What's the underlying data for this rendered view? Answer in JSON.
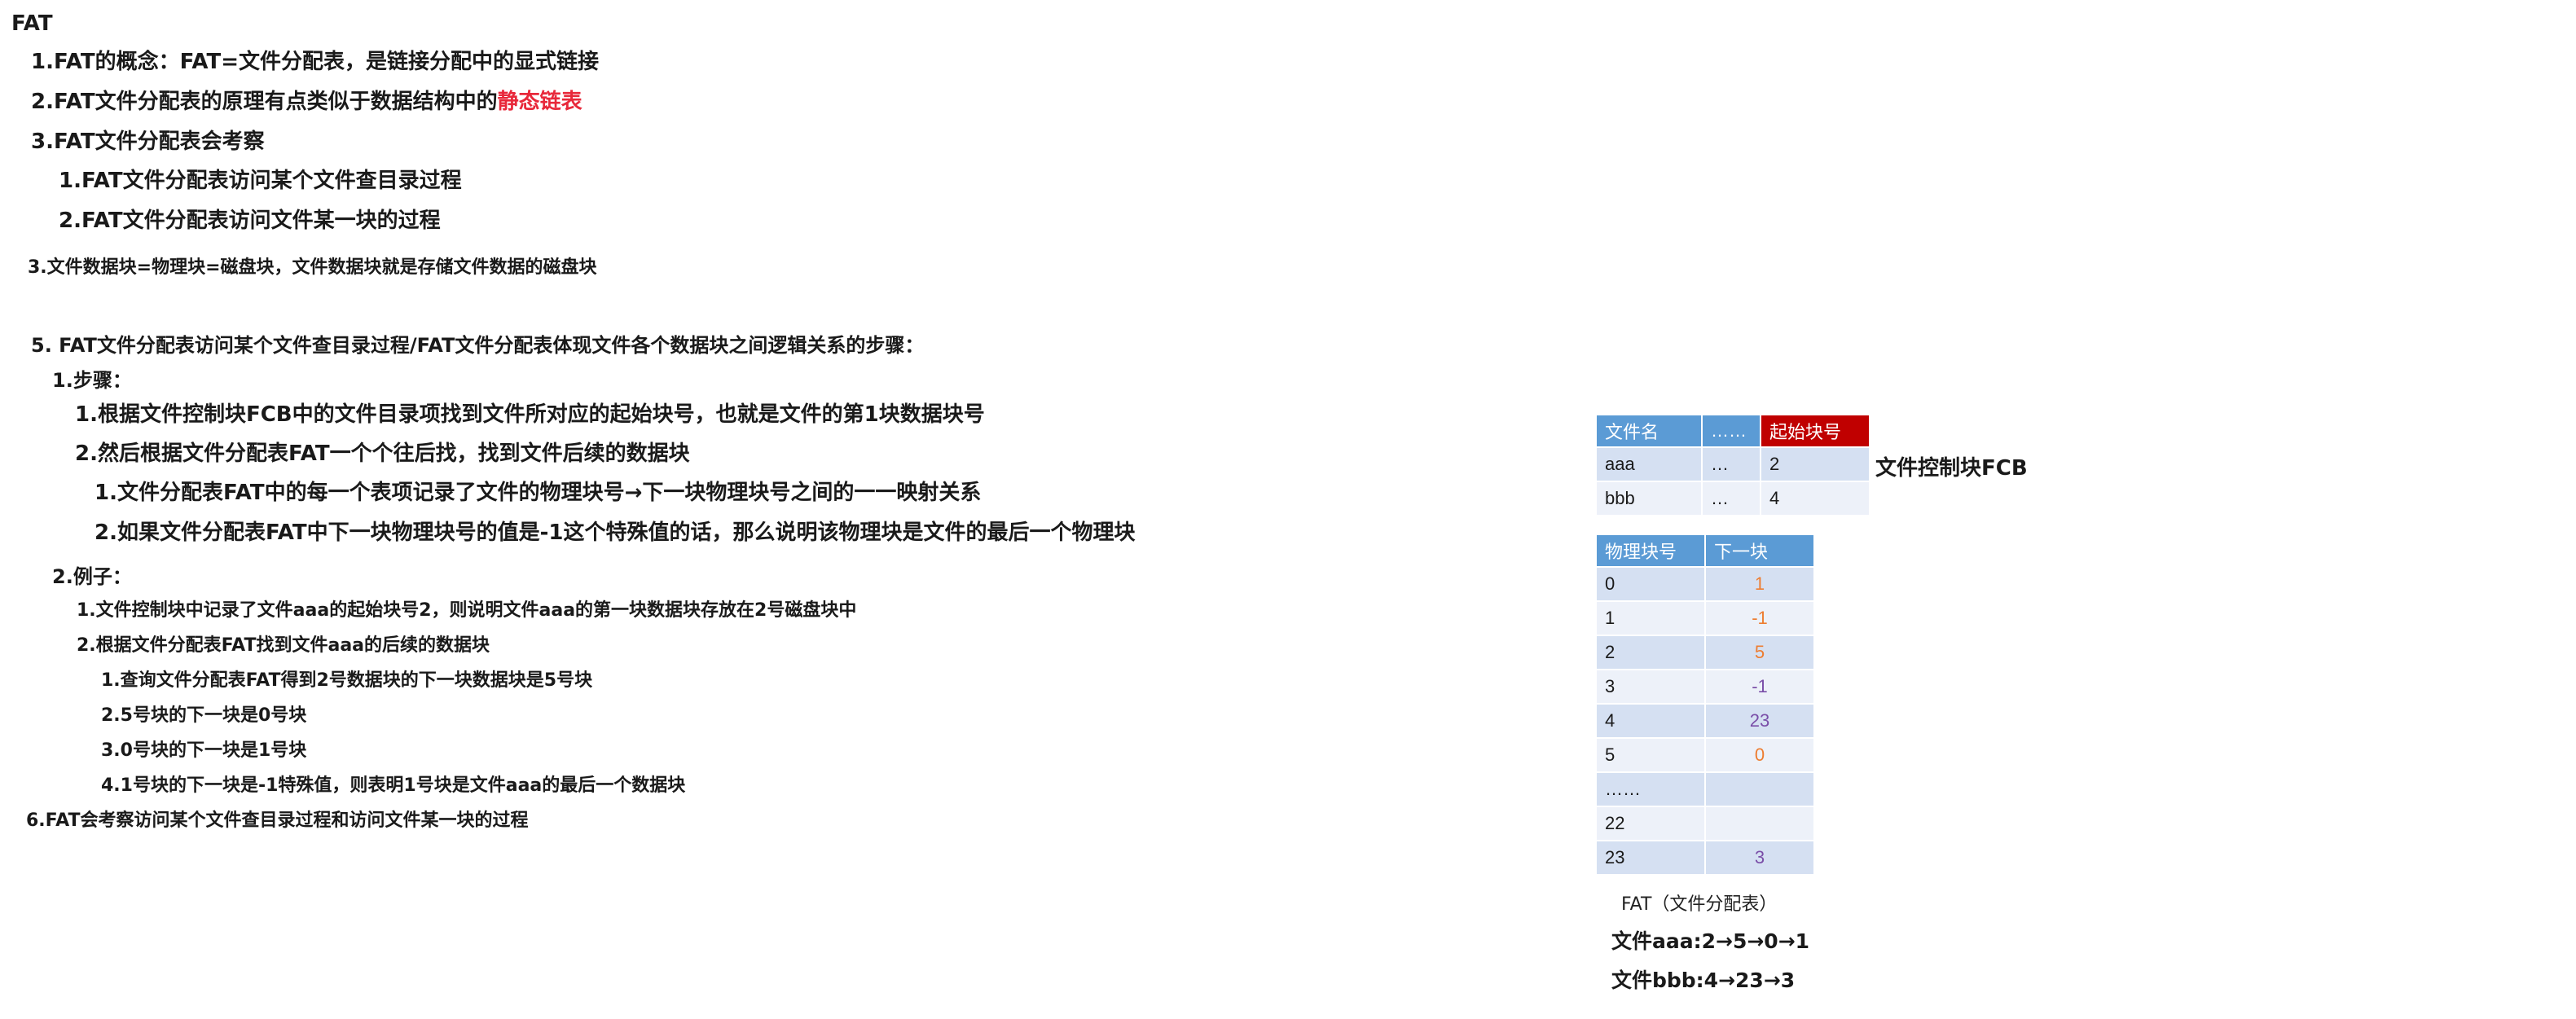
{
  "notes": {
    "title": "FAT",
    "p1": "1.FAT的概念：FAT=文件分配表，是链接分配中的显式链接",
    "p2_prefix": "2.FAT文件分配表的原理有点类似于数据结构中的",
    "p2_highlight": "静态链表",
    "p3": "3.FAT文件分配表会考察",
    "p3_1": "1.FAT文件分配表访问某个文件查目录过程",
    "p3_2": "2.FAT文件分配表访问文件某一块的过程",
    "p4": "3.文件数据块=物理块=磁盘块，文件数据块就是存储文件数据的磁盘块",
    "p5": "5. FAT文件分配表访问某个文件查目录过程/FAT文件分配表体现文件各个数据块之间逻辑关系的步骤：",
    "p5_steps": "1.步骤：",
    "p5_s1": "1.根据文件控制块FCB中的文件目录项找到文件所对应的起始块号，也就是文件的第1块数据块号",
    "p5_s2": "2.然后根据文件分配表FAT一个个往后找，找到文件后续的数据块",
    "p5_s2_1": "1.文件分配表FAT中的每一个表项记录了文件的物理块号→下一块物理块号之间的一一映射关系",
    "p5_s2_2": "2.如果文件分配表FAT中下一块物理块号的值是-1这个特殊值的话，那么说明该物理块是文件的最后一个物理块",
    "p5_example": "2.例子：",
    "p5_e1": "1.文件控制块中记录了文件aaa的起始块号2，则说明文件aaa的第一块数据块存放在2号磁盘块中",
    "p5_e2": "2.根据文件分配表FAT找到文件aaa的后续的数据块",
    "p5_e2_1": "1.查询文件分配表FAT得到2号数据块的下一块数据块是5号块",
    "p5_e2_2": "2.5号块的下一块是0号块",
    "p5_e2_3": "3.0号块的下一块是1号块",
    "p5_e2_4": "4.1号块的下一块是-1特殊值，则表明1号块是文件aaa的最后一个数据块",
    "p6": "6.FAT会考察访问某个文件查目录过程和访问文件某一块的过程"
  },
  "fcb": {
    "headers": [
      "文件名",
      "……",
      "起始块号"
    ],
    "rows": [
      [
        "aaa",
        "…",
        "2"
      ],
      [
        "bbb",
        "…",
        "4"
      ]
    ],
    "label": "文件控制块FCB"
  },
  "fat": {
    "headers": [
      "物理块号",
      "下一块"
    ],
    "rows": [
      [
        "0",
        "1"
      ],
      [
        "1",
        "-1"
      ],
      [
        "2",
        "5"
      ],
      [
        "3",
        "-1"
      ],
      [
        "4",
        "23"
      ],
      [
        "5",
        "0"
      ],
      [
        "……",
        ""
      ],
      [
        "22",
        ""
      ],
      [
        "23",
        "3"
      ]
    ],
    "caption": "FAT（文件分配表）",
    "chain_aaa": "文件aaa:2→5→0→1",
    "chain_bbb": "文件bbb:4→23→3"
  },
  "colors": {
    "header_blue": "#5b9bd5",
    "header_red": "#c00000",
    "row_dark": "#d5e0f2",
    "row_light": "#edf1f9",
    "value_orange": "#ed7d31",
    "value_purple": "#7a4ea8",
    "highlight_red": "#e8283a"
  }
}
